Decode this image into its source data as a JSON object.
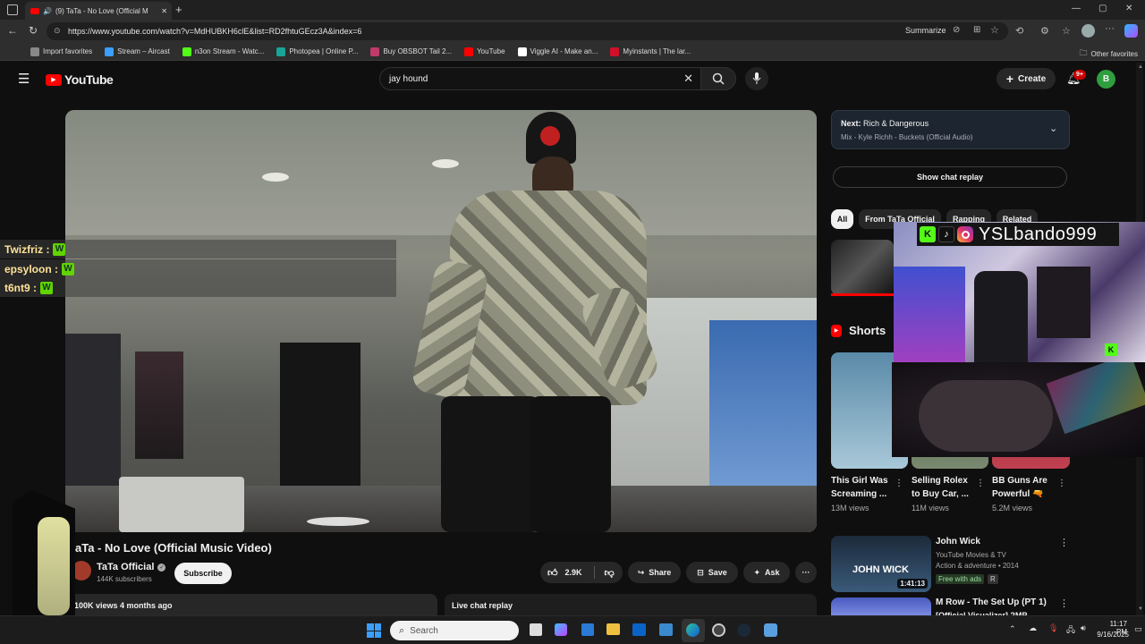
{
  "browser": {
    "tab_title": "(9) TaTa - No Love (Official M",
    "new_tab": "+",
    "url": "https://www.youtube.com/watch?v=MdHUBKH6clE&list=RD2fhtuGEcz3A&index=6",
    "summarize": "Summarize",
    "window_min": "—",
    "window_max": "▢",
    "window_close": "✕"
  },
  "favorites": [
    {
      "label": "Import favorites",
      "color": "#888888"
    },
    {
      "label": "Stream – Aircast",
      "color": "#3aa0ff"
    },
    {
      "label": "n3on Stream - Watc...",
      "color": "#53fc18"
    },
    {
      "label": "Photopea | Online P...",
      "color": "#18a497"
    },
    {
      "label": "Buy OBSBOT Tail 2...",
      "color": "#c03a6a"
    },
    {
      "label": "YouTube",
      "color": "#ff0000"
    },
    {
      "label": "Viggle AI - Make an...",
      "color": "#ffffff"
    },
    {
      "label": "Myinstants | The lar...",
      "color": "#d0102a"
    }
  ],
  "other_favorites": "Other favorites",
  "youtube": {
    "logo": "YouTube",
    "search_value": "jay hound",
    "create": "Create",
    "notif_badge": "9+",
    "avatar": "B"
  },
  "video": {
    "title": "TaTa - No Love (Official Music Video)",
    "title_visible": "aTa - No Love (Official Music Video)",
    "channel": "TaTa Official",
    "subscribers": "144K subscribers",
    "subscribe": "Subscribe",
    "likes": "2.9K",
    "share": "Share",
    "save": "Save",
    "ask": "Ask",
    "more": "···",
    "views": "100K views",
    "age": "4 months ago",
    "live_chat": "Live chat replay"
  },
  "sidebar": {
    "next_label": "Next:",
    "next_title": "Rich & Dangerous",
    "next_sub": "Mix - Kyle Richh - Buckets (Official Audio)",
    "show_chat": "Show chat replay",
    "chips": [
      "All",
      "From TaTa Official",
      "Rapping",
      "Related"
    ],
    "shorts_title": "Shorts",
    "shorts": [
      {
        "title": "This Girl Was Screaming ...",
        "views": "13M views"
      },
      {
        "title": "Selling Rolex to Buy Car, ...",
        "views": "11M views"
      },
      {
        "title": "BB Guns Are Powerful 🔫",
        "views": "5.2M views"
      }
    ],
    "videos": [
      {
        "title": "John Wick",
        "channel": "YouTube Movies & TV",
        "meta": "Action & adventure • 2014",
        "badge": "Free with ads",
        "rating": "R",
        "duration": "1:41:13",
        "thumb_text": "JOHN WICK"
      },
      {
        "title": "M Row - The Set Up (PT 1)",
        "sub": "[Official Visualizer] ?MP..."
      }
    ]
  },
  "stream_overlay": {
    "handle": "YSLbando999",
    "chat": [
      {
        "user": "Twizfriz :",
        "msg": "W"
      },
      {
        "user": "epsyloon :",
        "msg": "W"
      },
      {
        "user": "t6nt9 :",
        "msg": "W"
      }
    ]
  },
  "taskbar": {
    "search": "Search",
    "time": "11:17 PM",
    "date": "9/16/2025"
  }
}
